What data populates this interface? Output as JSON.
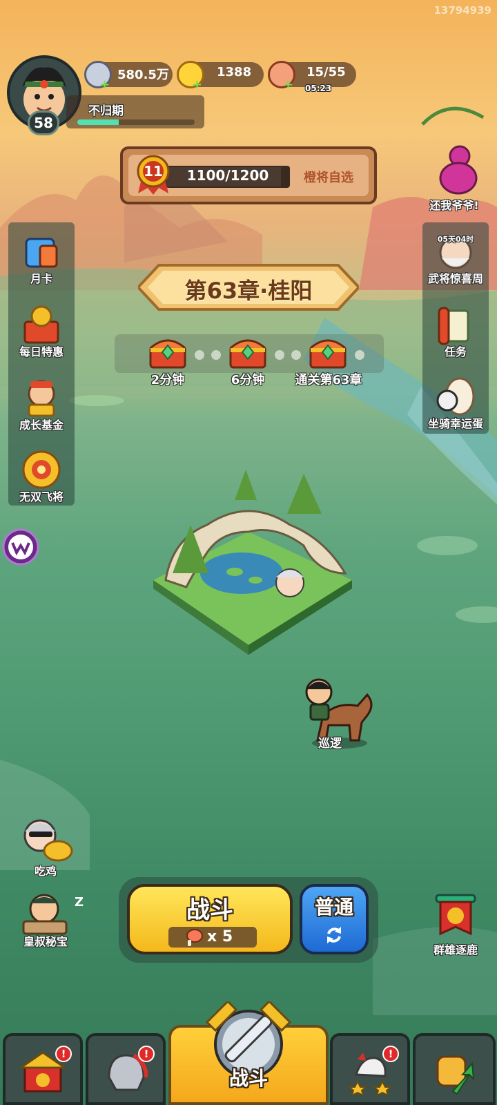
{
  "build_id": "13794939",
  "player": {
    "name": "不归期",
    "level": "58",
    "xp_progress": 0.35
  },
  "resources": {
    "silver": "580.5万",
    "gold": "1388",
    "stamina": "15/55",
    "stamina_timer": "05:23"
  },
  "progress_banner": {
    "medal_level": "11",
    "progress": "1100/1200",
    "link": "橙将自选"
  },
  "chapter": {
    "title": "第63章·桂阳"
  },
  "chests": [
    {
      "label": "2分钟"
    },
    {
      "label": "6分钟"
    },
    {
      "label": "通关第63章"
    }
  ],
  "left_menu": [
    {
      "label": "月卡",
      "icon": "monthly-card-icon"
    },
    {
      "label": "每日特惠",
      "icon": "daily-deal-icon"
    },
    {
      "label": "成长基金",
      "icon": "growth-fund-icon"
    },
    {
      "label": "无双飞将",
      "icon": "peerless-general-icon"
    }
  ],
  "right_menu": [
    {
      "label": "还我爷爷!",
      "icon": "gourd-icon"
    },
    {
      "label": "武将惊喜周",
      "icon": "general-surprise-icon",
      "timer": "05天04时"
    },
    {
      "label": "任务",
      "icon": "scroll-icon"
    },
    {
      "label": "坐骑幸运蛋",
      "icon": "mount-egg-icon"
    }
  ],
  "map": {
    "patrol_label": "巡逻"
  },
  "bottom_left": [
    {
      "label": "吃鸡",
      "icon": "eat-chicken-icon"
    },
    {
      "label": "皇叔秘宝",
      "icon": "uncle-treasure-icon",
      "sleep": "Z"
    }
  ],
  "bottom_right": {
    "label": "群雄逐鹿",
    "icon": "warlords-banner-icon"
  },
  "battle": {
    "title": "战斗",
    "cost": "x 5",
    "mode": "普通"
  },
  "tabs": [
    {
      "name": "city",
      "icon": "city-gate-icon",
      "badge": "!"
    },
    {
      "name": "heroes",
      "icon": "helmet-icon",
      "badge": "!"
    },
    {
      "name": "battle",
      "icon": "crossed-swords-icon",
      "label": "战斗"
    },
    {
      "name": "ranking",
      "icon": "rooster-stars-icon",
      "badge": "!"
    },
    {
      "name": "upgrade",
      "icon": "fist-arrow-icon"
    }
  ],
  "colors": {
    "battle_yellow": "#ffd43a",
    "mode_blue": "#2e86e4",
    "badge_red": "#e02a2a"
  }
}
